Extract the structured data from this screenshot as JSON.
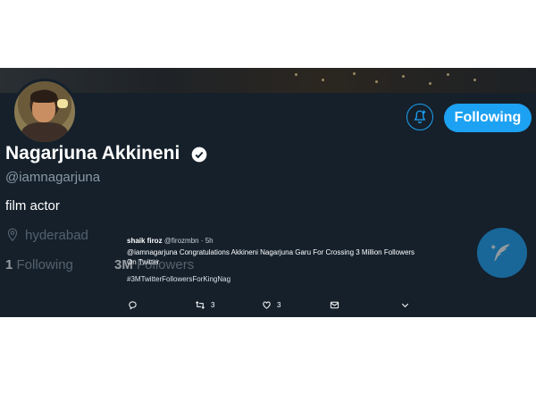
{
  "profile": {
    "name": "Nagarjuna Akkineni",
    "handle": "@iamnagarjuna",
    "bio": "film actor",
    "location": "hyderabad",
    "following_count": "1",
    "following_label": "Following",
    "followers_count": "3M",
    "followers_label": "Followers",
    "follow_button_label": "Following"
  },
  "tweet": {
    "author_name": "shaik firoz",
    "author_handle": "@firozmbn",
    "time": "· 5h",
    "text": "@iamnagarjuna Congratulations Akkineni Nagarjuna Garu For Crossing 3 Million Followers On Twitter",
    "hashtag": "#3MTwitterFollowersForKingNag",
    "retweets": "3",
    "likes": "3"
  },
  "icons": [
    "bell-add-icon",
    "verified-badge-icon",
    "location-pin-icon",
    "compose-tweet-icon",
    "reply-icon",
    "retweet-icon",
    "like-icon",
    "direct-message-icon",
    "chevron-down-icon"
  ],
  "colors": {
    "background": "#15202b",
    "accent": "#1da1f2",
    "secondary_text": "#8899a6"
  }
}
